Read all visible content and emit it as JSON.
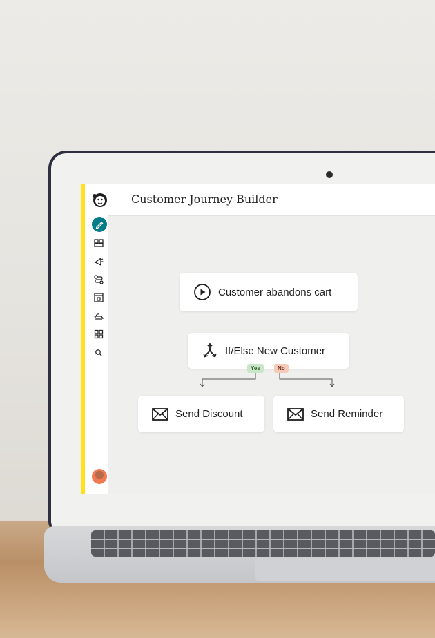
{
  "app": {
    "page_title": "Customer Journey Builder"
  },
  "sidebar": {
    "accent_color": "#ffe01b",
    "active_color": "#007c89",
    "items": [
      {
        "icon": "pencil-icon",
        "active": true
      },
      {
        "icon": "audience-icon"
      },
      {
        "icon": "campaigns-icon"
      },
      {
        "icon": "automations-icon"
      },
      {
        "icon": "website-icon"
      },
      {
        "icon": "content-icon"
      },
      {
        "icon": "integrations-icon"
      },
      {
        "icon": "search-icon"
      }
    ],
    "avatar": "user-avatar"
  },
  "journey": {
    "trigger": {
      "label": "Customer abandons cart",
      "icon": "play-icon"
    },
    "condition": {
      "label_prefix": "If/Else",
      "label_suffix": "New Customer",
      "icon": "split-icon"
    },
    "branches": {
      "yes": {
        "label": "Yes",
        "color": "#c9e7c6"
      },
      "no": {
        "label": "No",
        "color": "#f7c9b8"
      }
    },
    "actions": [
      {
        "label": "Send Discount",
        "icon": "envelope-icon"
      },
      {
        "label": "Send Reminder",
        "icon": "envelope-icon"
      }
    ]
  }
}
